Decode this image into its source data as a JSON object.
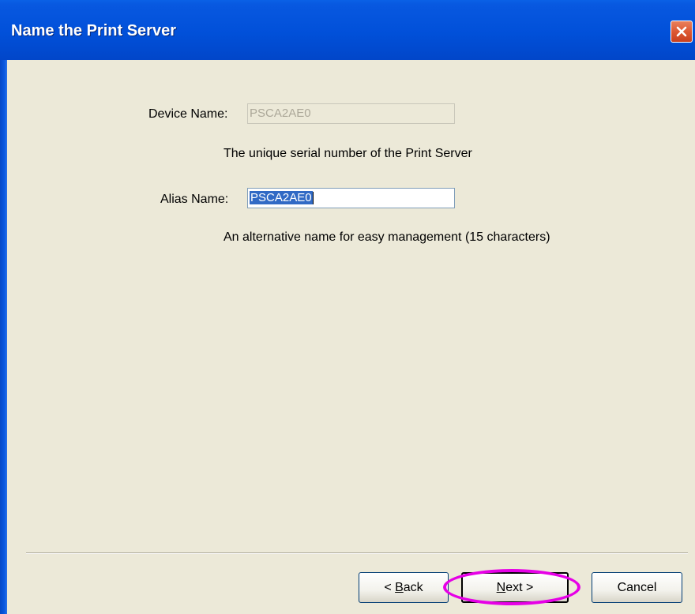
{
  "window": {
    "title": "Name the Print Server"
  },
  "form": {
    "device_name_label": "Device Name:",
    "device_name_value": "PSCA2AE0",
    "device_name_hint": "The unique serial number of the Print Server",
    "alias_name_label": "Alias Name:",
    "alias_name_value": "PSCA2AE0",
    "alias_name_hint": "An alternative name for easy management (15 characters)"
  },
  "buttons": {
    "back_prefix": "< ",
    "back_accel": "B",
    "back_rest": "ack",
    "next_accel": "N",
    "next_rest": "ext >",
    "cancel": "Cancel"
  },
  "icons": {
    "close": "close-icon"
  },
  "colors": {
    "titlebar": "#0150d9",
    "dialog_bg": "#ece9d8",
    "selection": "#316ac5",
    "highlight_ring": "#e600e6",
    "close_button": "#dd5833"
  }
}
